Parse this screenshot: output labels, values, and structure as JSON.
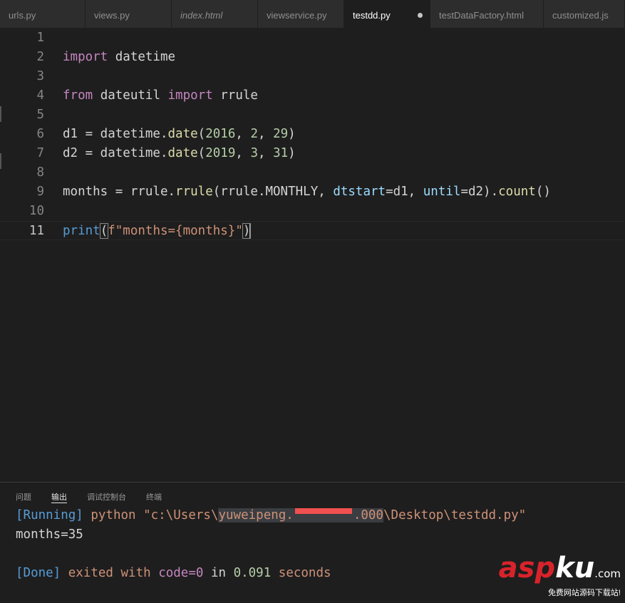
{
  "tabs": [
    {
      "label": "urls.py",
      "w": 120
    },
    {
      "label": "views.py",
      "w": 121
    },
    {
      "label": "index.html",
      "w": 121,
      "italic": true
    },
    {
      "label": "viewservice.py",
      "w": 121
    },
    {
      "label": "testdd.py",
      "w": 121,
      "active": true,
      "modified": true
    },
    {
      "label": "testDataFactory.html",
      "w": 159
    },
    {
      "label": "customized.js",
      "w": 114
    }
  ],
  "editor": {
    "line_numbers": [
      "1",
      "2",
      "3",
      "4",
      "5",
      "6",
      "7",
      "8",
      "9",
      "10",
      "11"
    ],
    "lines": [
      [],
      [
        [
          "kw",
          "import"
        ],
        [
          "",
          "  datetime"
        ]
      ],
      [],
      [
        [
          "kw",
          "from"
        ],
        [
          "",
          " dateutil "
        ],
        [
          "kw",
          "import"
        ],
        [
          "",
          " rrule"
        ]
      ],
      [],
      [
        [
          "",
          " d1 = datetime."
        ],
        [
          "fn",
          "date"
        ],
        [
          "",
          "("
        ],
        [
          "num",
          "2016"
        ],
        [
          "",
          ", "
        ],
        [
          "num",
          "2"
        ],
        [
          "",
          ", "
        ],
        [
          "num",
          "29"
        ],
        [
          "",
          ")"
        ]
      ],
      [
        [
          "",
          " d2 = datetime."
        ],
        [
          "fn",
          "date"
        ],
        [
          "",
          "("
        ],
        [
          "num",
          "2019"
        ],
        [
          "",
          ", "
        ],
        [
          "num",
          "3"
        ],
        [
          "",
          ", "
        ],
        [
          "num",
          "31"
        ],
        [
          "",
          ")"
        ]
      ],
      [],
      [
        [
          "",
          "months = rrule."
        ],
        [
          "fn",
          "rrule"
        ],
        [
          "",
          "(rrule.MONTHLY, "
        ],
        [
          "param",
          "dtstart"
        ],
        [
          "",
          "=d1, "
        ],
        [
          "param",
          "until"
        ],
        [
          "",
          "=d2)."
        ],
        [
          "fn",
          "count"
        ],
        [
          "",
          "()"
        ]
      ],
      [],
      [
        [
          "bi",
          "print"
        ],
        [
          "br",
          "("
        ],
        [
          "str",
          "f\"months={months}\""
        ],
        [
          "br",
          ")"
        ]
      ]
    ]
  },
  "panel": {
    "tabs": [
      "问题",
      "输出",
      "调试控制台",
      "终端"
    ],
    "active_tab": 1,
    "output": {
      "running_tag": "[Running]",
      "cmd_pre": " python \"c:\\Users\\",
      "user_a": "yuweipeng.",
      "user_b": ".000",
      "cmd_post": "\\Desktop\\testdd.py\"",
      "result": "months=35",
      "done_tag": "[Done]",
      "exited": " exited with ",
      "code": "code=0",
      "in": " in ",
      "time": "0.091",
      "seconds": " seconds"
    }
  },
  "watermark": {
    "asp": "asp",
    "ku": "ku",
    ".com": ".com",
    "com": ".com",
    "sub": "免费网站源码下载站!"
  }
}
